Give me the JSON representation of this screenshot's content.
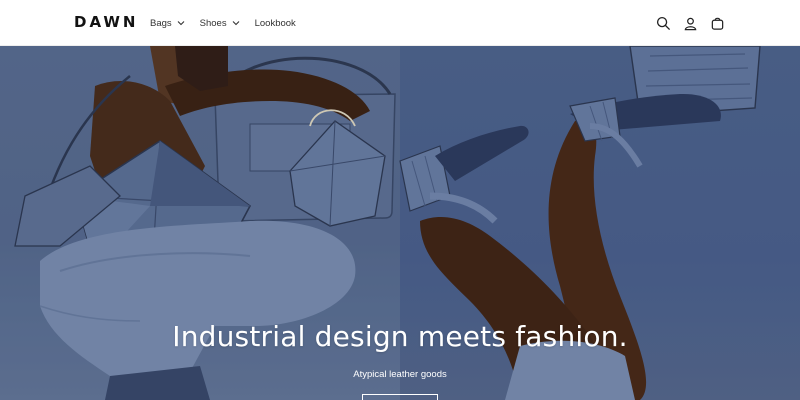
{
  "header": {
    "logo": "DAWN",
    "nav": [
      {
        "label": "Bags",
        "has_dropdown": true
      },
      {
        "label": "Shoes",
        "has_dropdown": true
      },
      {
        "label": "Lookbook",
        "has_dropdown": false
      }
    ],
    "icons": [
      "search-icon",
      "account-icon",
      "cart-icon"
    ]
  },
  "hero": {
    "title": "Industrial design meets fashion.",
    "subtitle": "Atypical leather goods",
    "button_label": ""
  },
  "colors": {
    "background": "#ffffff",
    "text": "#121212",
    "hero_blue": "#53688f",
    "skin": "#5a3a26",
    "denim": "#7a8fb2"
  }
}
